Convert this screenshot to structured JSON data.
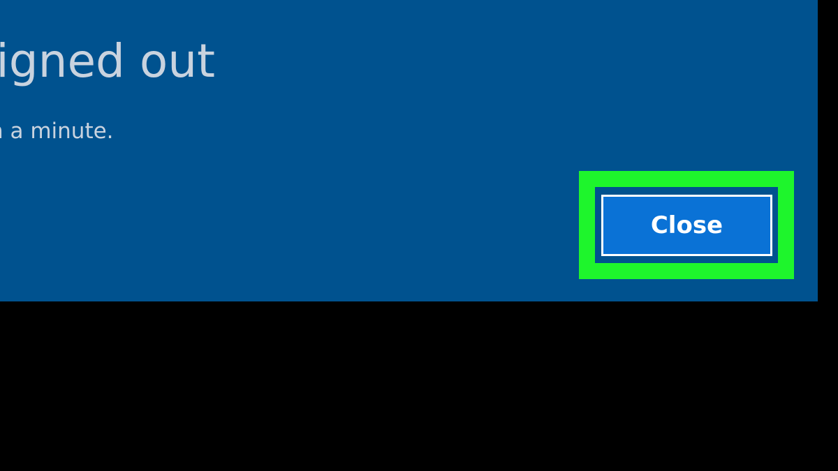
{
  "dialog": {
    "title": "signed out",
    "message": "n a minute.",
    "close_button_label": "Close"
  },
  "colors": {
    "dialog_background": "#00528f",
    "button_background": "#0a72d6",
    "highlight": "#1ef52c",
    "text": "#c9d3df",
    "screen_background": "#000000"
  }
}
